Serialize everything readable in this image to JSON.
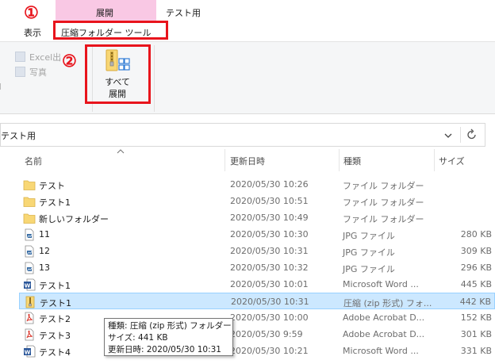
{
  "ribbon_tabs": {
    "view": "表示",
    "extract": "展開",
    "test": "テスト用",
    "compressed_tools": "圧縮フォルダー ツール"
  },
  "annotations": {
    "marker_1": "①",
    "marker_2": "②"
  },
  "ribbon": {
    "excel_label": "Excel出",
    "photo_label": "写真",
    "extract_all_label_line1": "すべて",
    "extract_all_label_line2": "展開"
  },
  "address_bar": {
    "path": "テスト用"
  },
  "columns": {
    "name": "名前",
    "date": "更新日時",
    "type": "種類",
    "size": "サイズ"
  },
  "files": [
    {
      "name": "テスト",
      "date": "2020/05/30 10:26",
      "type": "ファイル フォルダー",
      "size": "",
      "icon": "folder-icon"
    },
    {
      "name": "テスト1",
      "date": "2020/05/30 10:51",
      "type": "ファイル フォルダー",
      "size": "",
      "icon": "folder-icon"
    },
    {
      "name": "新しいフォルダー",
      "date": "2020/05/30 10:49",
      "type": "ファイル フォルダー",
      "size": "",
      "icon": "folder-icon"
    },
    {
      "name": "11",
      "date": "2020/05/30 10:30",
      "type": "JPG ファイル",
      "size": "280 KB",
      "icon": "image-file-icon"
    },
    {
      "name": "12",
      "date": "2020/05/30 10:31",
      "type": "JPG ファイル",
      "size": "309 KB",
      "icon": "image-file-icon"
    },
    {
      "name": "13",
      "date": "2020/05/30 10:32",
      "type": "JPG ファイル",
      "size": "296 KB",
      "icon": "image-file-icon"
    },
    {
      "name": "テスト1",
      "date": "2020/05/30 10:01",
      "type": "Microsoft Word ...",
      "size": "445 KB",
      "icon": "word-file-icon"
    },
    {
      "name": "テスト1",
      "date": "2020/05/30 10:31",
      "type": "圧縮 (zip 形式) フォ...",
      "size": "442 KB",
      "icon": "zip-folder-icon"
    },
    {
      "name": "テスト2",
      "date": "2020/05/30 10:00",
      "type": "Adobe Acrobat D...",
      "size": "152 KB",
      "icon": "pdf-file-icon"
    },
    {
      "name": "テスト3",
      "date": "2020/05/30 9:59",
      "type": "Adobe Acrobat D...",
      "size": "301 KB",
      "icon": "pdf-file-icon"
    },
    {
      "name": "テスト4",
      "date": "2020/05/30 10:21",
      "type": "Microsoft Word ...",
      "size": "331 KB",
      "icon": "word-file-icon"
    }
  ],
  "tooltip": {
    "type_line": "種類: 圧縮 (zip 形式) フォルダー",
    "size_line": "サイズ: 441 KB",
    "date_line": "更新日時: 2020/05/30 10:31"
  },
  "colors": {
    "contextual_tab": "#f9c8e4",
    "highlight_box": "#e8141c",
    "selection": "#cce8ff",
    "folder": "#f8d775",
    "word": "#2b579a",
    "pdf": "#d93025"
  }
}
